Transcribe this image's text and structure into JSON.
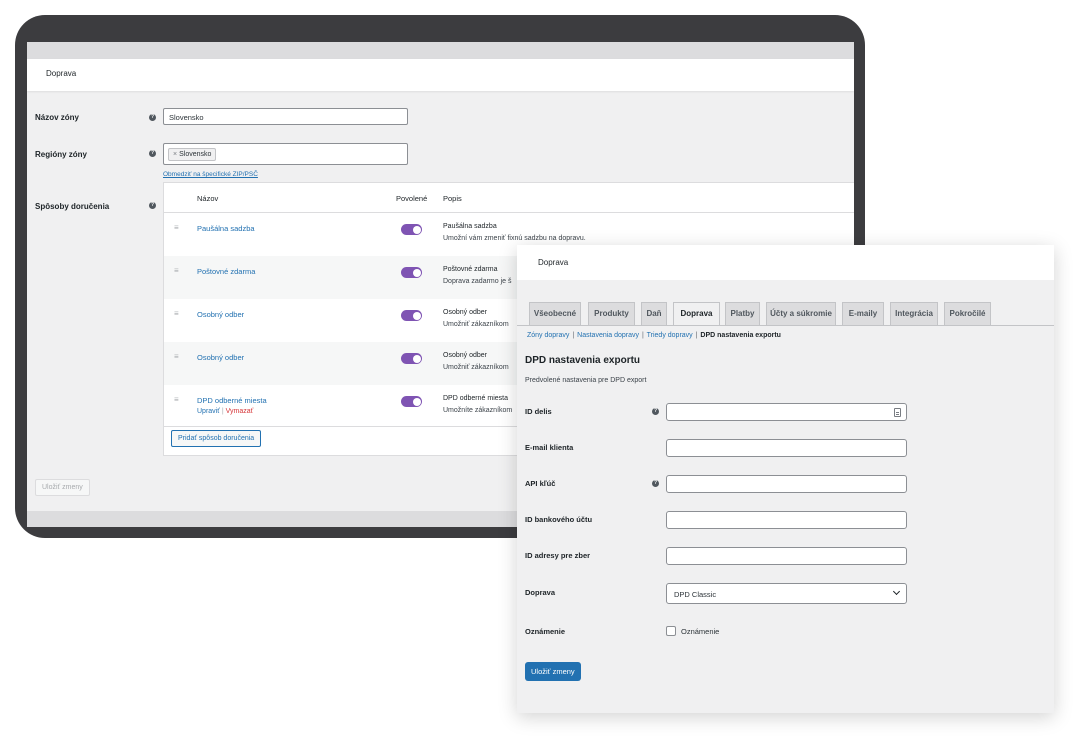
{
  "back": {
    "header_title": "Doprava",
    "zone_name_label": "Názov zóny",
    "zone_name_value": "Slovensko",
    "zone_regions_label": "Regióny zóny",
    "region_tag": "Slovensko",
    "limit_link": "Obmedziť na špecifické ZIP/PSČ",
    "methods_label": "Spôsoby doručenia",
    "columns": [
      "Názov",
      "Povolené",
      "Popis"
    ],
    "methods": [
      {
        "name": "Paušálna sadzba",
        "title": "Paušálna sadzba",
        "desc": "Umožní vám zmeniť fixnú sadzbu na dopravu.",
        "enabled": true
      },
      {
        "name": "Poštovné zdarma",
        "title": "Poštovné zdarma",
        "desc": "Doprava zadarmo je š",
        "enabled": true
      },
      {
        "name": "Osobný odber",
        "title": "Osobný odber",
        "desc": "Umožniť zákazníkom",
        "enabled": true
      },
      {
        "name": "Osobný odber",
        "title": "Osobný odber",
        "desc": "Umožniť zákazníkom",
        "enabled": true
      },
      {
        "name": "DPD odberné miesta",
        "title": "DPD odberné miesta",
        "desc": "Umožníte zákazníkom",
        "enabled": true
      }
    ],
    "row_edit": "Upraviť",
    "row_sep": "|",
    "row_delete": "Vymazať",
    "add_method_button": "Pridať spôsob doručenia",
    "save_button": "Uložiť zmeny"
  },
  "front": {
    "header_title": "Doprava",
    "tabs": [
      "Všeobecné",
      "Produkty",
      "Daň",
      "Doprava",
      "Platby",
      "Účty a súkromie",
      "E-maily",
      "Integrácia",
      "Pokročilé"
    ],
    "active_tab": "Doprava",
    "subnav": {
      "item1": "Zóny dopravy",
      "item2": "Nastavenia dopravy",
      "item3": "Triedy dopravy",
      "current": "DPD nastavenia exportu",
      "sep": "|"
    },
    "section_title": "DPD nastavenia exportu",
    "section_desc": "Predvolené nastavenia pre DPD export",
    "fields": {
      "delis_id": "ID delis",
      "client_email": "E-mail klienta",
      "api_key": "API kľúč",
      "bank_account_id": "ID bankového účtu",
      "pickup_address_id": "ID adresy pre zber",
      "shipping": "Doprava",
      "notification": "Oznámenie"
    },
    "shipping_selected": "DPD Classic",
    "notification_checkbox_label": "Oznámenie",
    "save_button": "Uložiť zmeny"
  },
  "colors": {
    "accent": "#2271b1",
    "toggle_on": "#7f54b3",
    "delete": "#d63638",
    "device_frame": "#3c3c3f"
  }
}
